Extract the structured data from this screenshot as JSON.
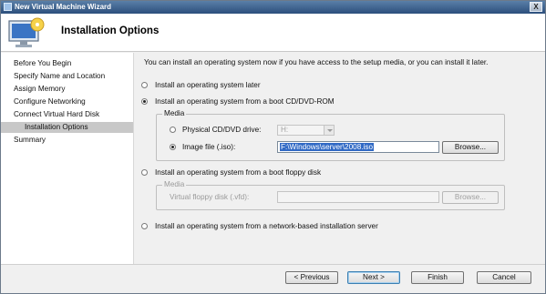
{
  "window": {
    "title": "New Virtual Machine Wizard",
    "close_label": "X"
  },
  "header": {
    "title": "Installation Options"
  },
  "sidebar": {
    "items": [
      {
        "label": "Before You Begin"
      },
      {
        "label": "Specify Name and Location"
      },
      {
        "label": "Assign Memory"
      },
      {
        "label": "Configure Networking"
      },
      {
        "label": "Connect Virtual Hard Disk"
      },
      {
        "label": "Installation Options",
        "active": true
      },
      {
        "label": "Summary"
      }
    ]
  },
  "main": {
    "intro": "You can install an operating system now if you have access to the setup media, or you can install it later.",
    "options": {
      "later": {
        "label": "Install an operating system later",
        "selected": false
      },
      "cd": {
        "label": "Install an operating system from a boot CD/DVD-ROM",
        "selected": true
      },
      "floppy": {
        "label": "Install an operating system from a boot floppy disk",
        "selected": false
      },
      "network": {
        "label": "Install an operating system from a network-based installation server",
        "selected": false
      }
    },
    "cd_media": {
      "legend": "Media",
      "physical_label": "Physical CD/DVD drive:",
      "physical_value": "H:",
      "image_label": "Image file (.iso):",
      "image_value": "F:\\Windows\\server\\2008.iso",
      "browse_label": "Browse..."
    },
    "floppy_media": {
      "legend": "Media",
      "vfd_label": "Virtual floppy disk (.vfd):",
      "vfd_value": "",
      "browse_label": "Browse..."
    }
  },
  "footer": {
    "previous_label": "< Previous",
    "next_label": "Next >",
    "finish_label": "Finish",
    "cancel_label": "Cancel"
  },
  "colors": {
    "titlebar": "#2c4f7c",
    "selection": "#316ac5",
    "active_nav": "#c8c8c8"
  }
}
